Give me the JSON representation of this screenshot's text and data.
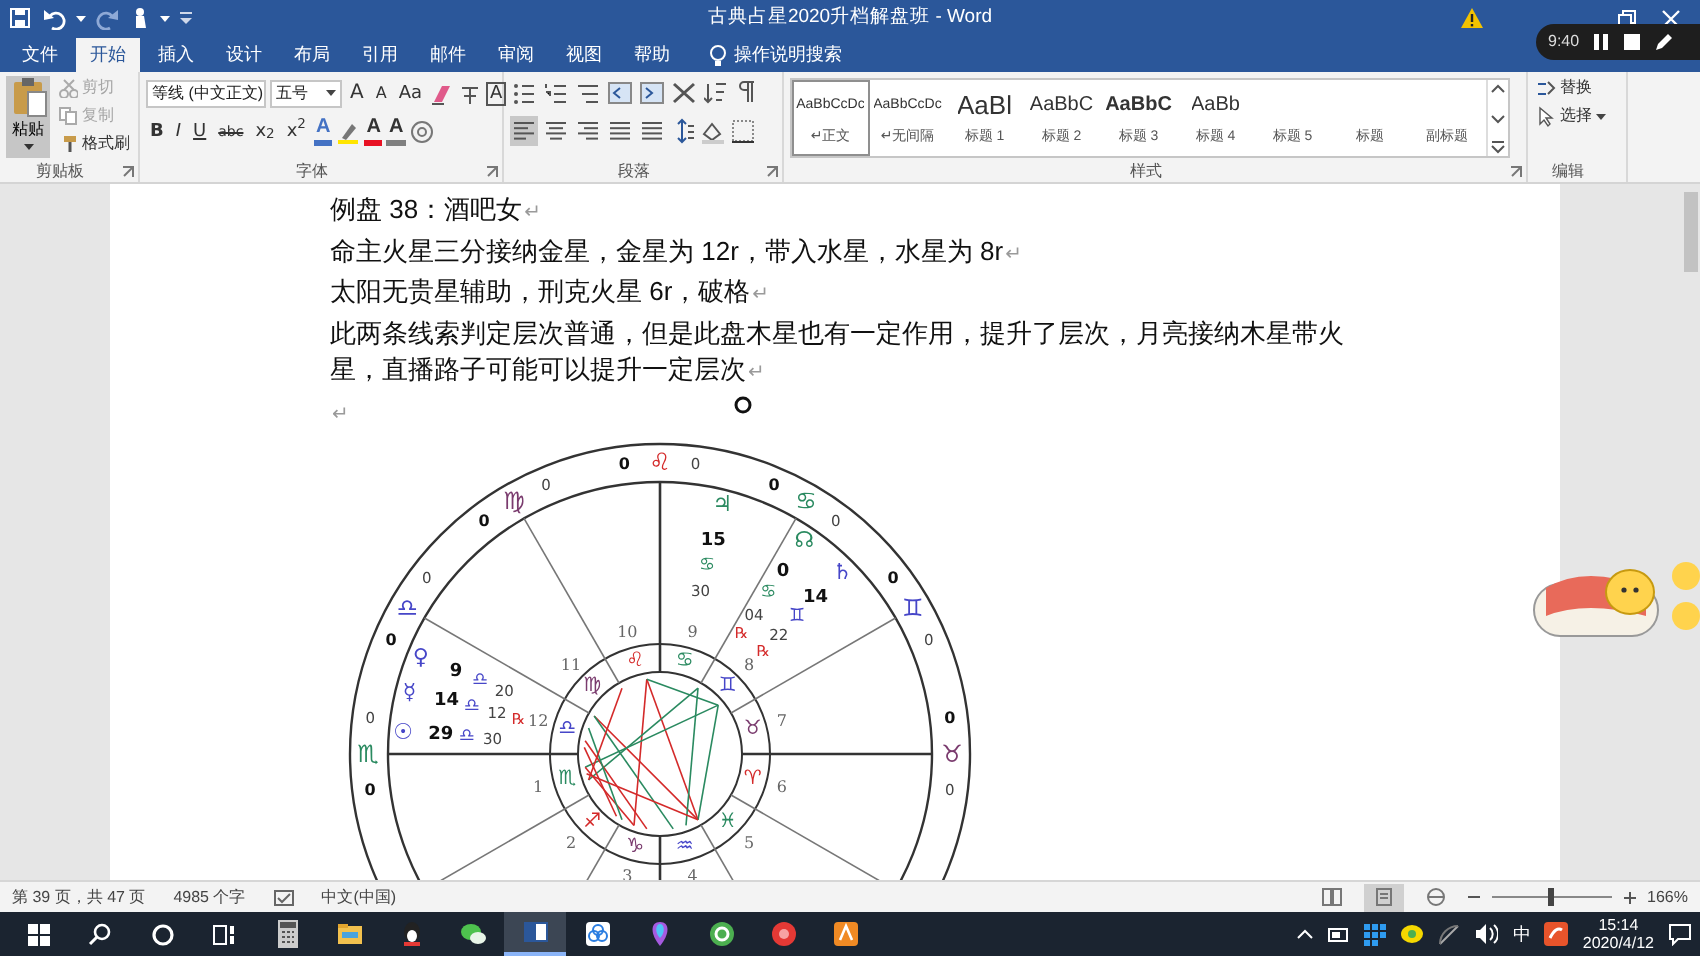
{
  "window": {
    "title": "古典占星2020升档解盘班 - Word"
  },
  "recorder": {
    "time": "9:40"
  },
  "tabs": [
    {
      "label": "文件",
      "selected": false
    },
    {
      "label": "开始",
      "selected": true
    },
    {
      "label": "插入",
      "selected": false
    },
    {
      "label": "设计",
      "selected": false
    },
    {
      "label": "布局",
      "selected": false
    },
    {
      "label": "引用",
      "selected": false
    },
    {
      "label": "邮件",
      "selected": false
    },
    {
      "label": "审阅",
      "selected": false
    },
    {
      "label": "视图",
      "selected": false
    },
    {
      "label": "帮助",
      "selected": false
    }
  ],
  "tell_me": {
    "placeholder": "操作说明搜索"
  },
  "ribbon": {
    "clipboard": {
      "label": "剪贴板",
      "paste": "粘贴",
      "items": [
        {
          "label": "剪切",
          "disabled": true
        },
        {
          "label": "复制",
          "disabled": true
        },
        {
          "label": "格式刷",
          "disabled": false
        }
      ]
    },
    "font": {
      "label": "字体",
      "name": "等线 (中文正文)",
      "size": "五号",
      "grow": "A",
      "shrink": "A",
      "case": "Aa",
      "border_char": "A",
      "format_buttons": [
        "B",
        "I",
        "U",
        "abc",
        "x$_{2}$",
        "x$^{2}$"
      ],
      "color_buttons": [
        {
          "text": "A",
          "color": "#4472c4"
        },
        {
          "text": "A",
          "color": "#e81123"
        },
        {
          "text": "A",
          "color": "#7f7f7f"
        }
      ]
    },
    "paragraph": {
      "label": "段落",
      "alignment": [
        {
          "selected": true
        },
        {
          "selected": false
        },
        {
          "selected": false
        },
        {
          "selected": false
        },
        {
          "selected": false
        }
      ]
    },
    "styles": {
      "label": "样式",
      "items": [
        {
          "preview": "AaBbCcDc",
          "mark": "↵",
          "name": "正文",
          "selected": true
        },
        {
          "preview": "AaBbCcDc",
          "mark": "↵",
          "name": "无间隔",
          "selected": false
        },
        {
          "preview": "AaBl",
          "name": "标题 1",
          "selected": false
        },
        {
          "preview": "AaBbC",
          "name": "标题 2",
          "selected": false
        },
        {
          "preview": "AaBbC",
          "name": "标题 3",
          "selected": false
        },
        {
          "preview": "AaBb",
          "name": "标题 4",
          "selected": false
        },
        {
          "name": "标题 5",
          "selected": false
        },
        {
          "name": "标题",
          "selected": false
        },
        {
          "name": "副标题",
          "selected": false
        }
      ]
    },
    "editing": {
      "label": "编辑",
      "items": [
        "替换",
        "选择"
      ]
    }
  },
  "document": {
    "paragraphs": [
      {
        "text": "例盘 38：酒吧女",
        "mark": "↵"
      },
      {
        "text": "命主火星三分接纳金星，金星为 12r，带入水星，水星为 8r",
        "mark": "↵"
      },
      {
        "text": "太阳无贵星辅助，刑克火星 6r，破格",
        "mark": "↵"
      },
      {
        "text": "此两条线索判定层次普通，但是此盘木星也有一定作用，提升了层次，月亮接纳木星带火星，直播路子可能可以提升一定层次",
        "mark": "↵"
      },
      {
        "mark": "↵"
      }
    ],
    "chart": {
      "cusps": [
        {
          "sign": "♏",
          "color": "#2a8a60",
          "degree": "0",
          "minute": "0"
        },
        {
          "sign": "♎",
          "color": "#4646c8",
          "degree": "0",
          "minute": "0"
        },
        {
          "sign": "♍",
          "color": "#7a3b6e",
          "degree": "0",
          "minute": "0"
        },
        {
          "sign": "♌",
          "color": "#d42a2a",
          "degree": "0",
          "minute": "0"
        },
        {
          "sign": "♋",
          "color": "#2a8a60",
          "degree": "0",
          "minute": "0"
        },
        {
          "sign": "♊",
          "color": "#4646c8",
          "degree": "0",
          "minute": "0"
        },
        {
          "sign": "♉",
          "color": "#7a3b6e",
          "degree": "0",
          "minute": "0"
        }
      ],
      "houses": [
        {
          "number": "1",
          "sign": "♏",
          "color": "#2a8a60"
        },
        {
          "number": "2",
          "sign": "♐",
          "color": "#d42a2a"
        },
        {
          "number": "3",
          "sign": "♑",
          "color": "#7a3b6e"
        },
        {
          "number": "4",
          "sign": "♒",
          "color": "#4646c8"
        },
        {
          "number": "5",
          "sign": "♓",
          "color": "#2a8a60"
        },
        {
          "number": "6",
          "sign": "♈",
          "color": "#d42a2a"
        },
        {
          "number": "7",
          "sign": "♉",
          "color": "#7a3b6e"
        },
        {
          "number": "8",
          "sign": "♊",
          "color": "#4646c8"
        },
        {
          "number": "9",
          "sign": "♋",
          "color": "#2a8a60"
        },
        {
          "number": "10",
          "sign": "♌",
          "color": "#d42a2a"
        },
        {
          "number": "11",
          "sign": "♍",
          "color": "#7a3b6e"
        },
        {
          "number": "12",
          "sign": "♎",
          "color": "#4646c8"
        }
      ],
      "planets": [
        {
          "glyph": "♃",
          "color": "#2a8a60",
          "degree": "15",
          "sign": "♋",
          "minute": "30"
        },
        {
          "glyph": "☊",
          "color": "#2a8a60",
          "degree": "0",
          "sign": "♋",
          "minute": "04",
          "retrograde_mark": "℞"
        },
        {
          "glyph": "♄",
          "color": "#4646c8",
          "degree": "14",
          "sign": "♊",
          "minute": "22",
          "retrograde_mark": "℞"
        },
        {
          "glyph": "♀",
          "color": "#4646c8",
          "degree": "9",
          "sign": "♎",
          "minute": "20"
        },
        {
          "glyph": "☿",
          "color": "#4646c8",
          "degree": "14",
          "sign": "♎",
          "minute": "12",
          "retrograde_mark": "℞"
        },
        {
          "glyph": "☉",
          "color": "#4646c8",
          "degree": "29",
          "sign": "♎",
          "minute": "30"
        }
      ]
    }
  },
  "status_bar": {
    "page": "第 39 页，共 47 页",
    "words": "4985 个字",
    "language": "中文(中国)",
    "views": [
      {
        "selected": false
      },
      {
        "selected": true
      },
      {
        "selected": false
      }
    ],
    "zoom_slider": {
      "level": 0.5
    },
    "zoom": "166%"
  },
  "taskbar": {
    "apps": [
      {
        "selected": false
      },
      {
        "selected": false
      },
      {
        "selected": false
      },
      {
        "selected": false
      },
      {
        "selected": true
      },
      {
        "selected": false
      },
      {
        "selected": false
      },
      {
        "selected": false
      },
      {
        "selected": false
      },
      {
        "selected": false
      }
    ],
    "ime": "中",
    "time": "15:14",
    "date": "2020/4/12"
  }
}
